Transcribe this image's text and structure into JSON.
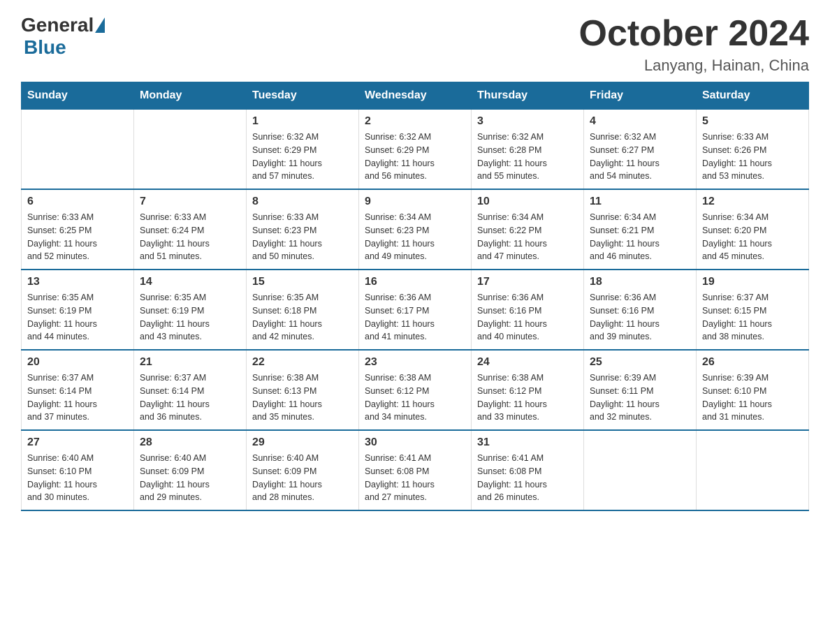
{
  "logo": {
    "general": "General",
    "blue": "Blue"
  },
  "title": "October 2024",
  "location": "Lanyang, Hainan, China",
  "days_of_week": [
    "Sunday",
    "Monday",
    "Tuesday",
    "Wednesday",
    "Thursday",
    "Friday",
    "Saturday"
  ],
  "weeks": [
    [
      {
        "day": "",
        "info": ""
      },
      {
        "day": "",
        "info": ""
      },
      {
        "day": "1",
        "info": "Sunrise: 6:32 AM\nSunset: 6:29 PM\nDaylight: 11 hours\nand 57 minutes."
      },
      {
        "day": "2",
        "info": "Sunrise: 6:32 AM\nSunset: 6:29 PM\nDaylight: 11 hours\nand 56 minutes."
      },
      {
        "day": "3",
        "info": "Sunrise: 6:32 AM\nSunset: 6:28 PM\nDaylight: 11 hours\nand 55 minutes."
      },
      {
        "day": "4",
        "info": "Sunrise: 6:32 AM\nSunset: 6:27 PM\nDaylight: 11 hours\nand 54 minutes."
      },
      {
        "day": "5",
        "info": "Sunrise: 6:33 AM\nSunset: 6:26 PM\nDaylight: 11 hours\nand 53 minutes."
      }
    ],
    [
      {
        "day": "6",
        "info": "Sunrise: 6:33 AM\nSunset: 6:25 PM\nDaylight: 11 hours\nand 52 minutes."
      },
      {
        "day": "7",
        "info": "Sunrise: 6:33 AM\nSunset: 6:24 PM\nDaylight: 11 hours\nand 51 minutes."
      },
      {
        "day": "8",
        "info": "Sunrise: 6:33 AM\nSunset: 6:23 PM\nDaylight: 11 hours\nand 50 minutes."
      },
      {
        "day": "9",
        "info": "Sunrise: 6:34 AM\nSunset: 6:23 PM\nDaylight: 11 hours\nand 49 minutes."
      },
      {
        "day": "10",
        "info": "Sunrise: 6:34 AM\nSunset: 6:22 PM\nDaylight: 11 hours\nand 47 minutes."
      },
      {
        "day": "11",
        "info": "Sunrise: 6:34 AM\nSunset: 6:21 PM\nDaylight: 11 hours\nand 46 minutes."
      },
      {
        "day": "12",
        "info": "Sunrise: 6:34 AM\nSunset: 6:20 PM\nDaylight: 11 hours\nand 45 minutes."
      }
    ],
    [
      {
        "day": "13",
        "info": "Sunrise: 6:35 AM\nSunset: 6:19 PM\nDaylight: 11 hours\nand 44 minutes."
      },
      {
        "day": "14",
        "info": "Sunrise: 6:35 AM\nSunset: 6:19 PM\nDaylight: 11 hours\nand 43 minutes."
      },
      {
        "day": "15",
        "info": "Sunrise: 6:35 AM\nSunset: 6:18 PM\nDaylight: 11 hours\nand 42 minutes."
      },
      {
        "day": "16",
        "info": "Sunrise: 6:36 AM\nSunset: 6:17 PM\nDaylight: 11 hours\nand 41 minutes."
      },
      {
        "day": "17",
        "info": "Sunrise: 6:36 AM\nSunset: 6:16 PM\nDaylight: 11 hours\nand 40 minutes."
      },
      {
        "day": "18",
        "info": "Sunrise: 6:36 AM\nSunset: 6:16 PM\nDaylight: 11 hours\nand 39 minutes."
      },
      {
        "day": "19",
        "info": "Sunrise: 6:37 AM\nSunset: 6:15 PM\nDaylight: 11 hours\nand 38 minutes."
      }
    ],
    [
      {
        "day": "20",
        "info": "Sunrise: 6:37 AM\nSunset: 6:14 PM\nDaylight: 11 hours\nand 37 minutes."
      },
      {
        "day": "21",
        "info": "Sunrise: 6:37 AM\nSunset: 6:14 PM\nDaylight: 11 hours\nand 36 minutes."
      },
      {
        "day": "22",
        "info": "Sunrise: 6:38 AM\nSunset: 6:13 PM\nDaylight: 11 hours\nand 35 minutes."
      },
      {
        "day": "23",
        "info": "Sunrise: 6:38 AM\nSunset: 6:12 PM\nDaylight: 11 hours\nand 34 minutes."
      },
      {
        "day": "24",
        "info": "Sunrise: 6:38 AM\nSunset: 6:12 PM\nDaylight: 11 hours\nand 33 minutes."
      },
      {
        "day": "25",
        "info": "Sunrise: 6:39 AM\nSunset: 6:11 PM\nDaylight: 11 hours\nand 32 minutes."
      },
      {
        "day": "26",
        "info": "Sunrise: 6:39 AM\nSunset: 6:10 PM\nDaylight: 11 hours\nand 31 minutes."
      }
    ],
    [
      {
        "day": "27",
        "info": "Sunrise: 6:40 AM\nSunset: 6:10 PM\nDaylight: 11 hours\nand 30 minutes."
      },
      {
        "day": "28",
        "info": "Sunrise: 6:40 AM\nSunset: 6:09 PM\nDaylight: 11 hours\nand 29 minutes."
      },
      {
        "day": "29",
        "info": "Sunrise: 6:40 AM\nSunset: 6:09 PM\nDaylight: 11 hours\nand 28 minutes."
      },
      {
        "day": "30",
        "info": "Sunrise: 6:41 AM\nSunset: 6:08 PM\nDaylight: 11 hours\nand 27 minutes."
      },
      {
        "day": "31",
        "info": "Sunrise: 6:41 AM\nSunset: 6:08 PM\nDaylight: 11 hours\nand 26 minutes."
      },
      {
        "day": "",
        "info": ""
      },
      {
        "day": "",
        "info": ""
      }
    ]
  ]
}
